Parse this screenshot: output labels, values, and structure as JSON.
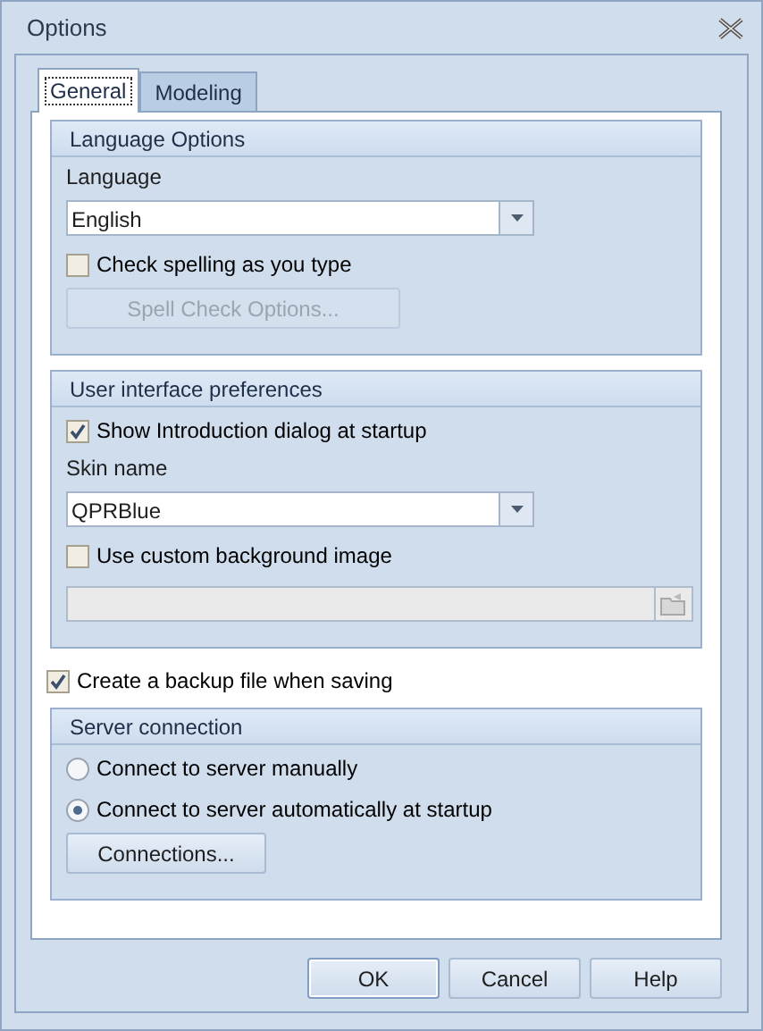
{
  "window": {
    "title": "Options"
  },
  "tabs": [
    {
      "label": "General",
      "selected": true
    },
    {
      "label": "Modeling",
      "selected": false
    }
  ],
  "sections": [
    {
      "kind": "group",
      "title": "Language Options",
      "items": [
        {
          "kind": "label",
          "text": "Language"
        },
        {
          "kind": "dropdown",
          "value": "English"
        },
        {
          "kind": "checkbox",
          "label": "Check spelling as you type",
          "checked": false
        },
        {
          "kind": "button",
          "label": "Spell Check Options...",
          "disabled": true
        }
      ]
    },
    {
      "kind": "group",
      "title": "User interface preferences",
      "items": [
        {
          "kind": "checkbox",
          "label": "Show Introduction dialog at startup",
          "checked": true
        },
        {
          "kind": "label",
          "text": "Skin name"
        },
        {
          "kind": "dropdown",
          "value": "QPRBlue"
        },
        {
          "kind": "checkbox",
          "label": "Use custom background image",
          "checked": false
        },
        {
          "kind": "file_field",
          "disabled": true
        }
      ]
    },
    {
      "kind": "checkbox",
      "label": "Create a backup file when saving",
      "checked": true
    },
    {
      "kind": "group",
      "title": "Server connection",
      "items": [
        {
          "kind": "radio",
          "label": "Connect to server manually",
          "selected": false
        },
        {
          "kind": "radio",
          "label": "Connect to server automatically at startup",
          "selected": true
        },
        {
          "kind": "button",
          "label": "Connections...",
          "disabled": false
        }
      ]
    }
  ],
  "buttons": [
    {
      "label": "OK",
      "default": true
    },
    {
      "label": "Cancel",
      "default": false
    },
    {
      "label": "Help",
      "default": false
    }
  ]
}
